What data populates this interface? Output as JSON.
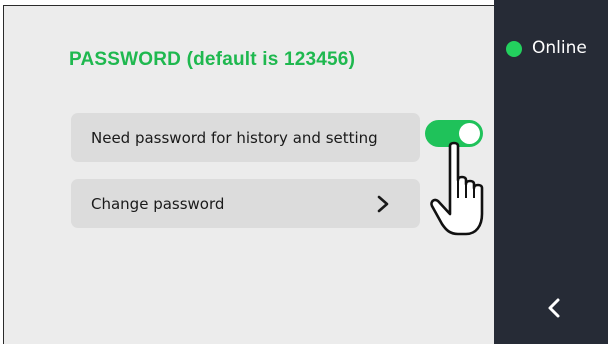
{
  "settings": {
    "title": "PASSWORD (default is 123456)",
    "need_password_label": "Need password for history and setting",
    "need_password_enabled": true,
    "change_password_label": "Change password"
  },
  "sidebar": {
    "status_text": "Online",
    "status_color": "#23d05e"
  },
  "colors": {
    "accent": "#1fb84f",
    "toggle_on": "#1fc25a",
    "sidebar_bg": "#262b36",
    "screen_bg": "#ececec"
  },
  "icons": [
    "chevron-right-icon",
    "back-arrow-icon",
    "pointing-hand-icon",
    "status-dot-icon"
  ]
}
